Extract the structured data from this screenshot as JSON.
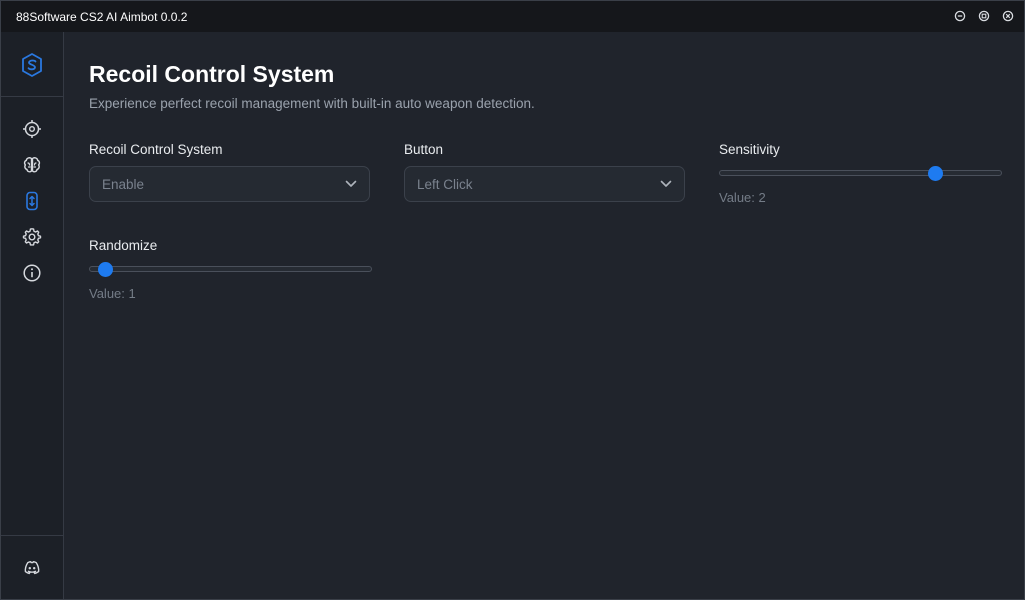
{
  "window": {
    "title": "88Software CS2 AI Aimbot 0.0.2",
    "controls": [
      "minimize-icon",
      "maximize-icon",
      "close-icon"
    ]
  },
  "sidebar": {
    "logo": "logo-icon",
    "items": [
      {
        "name": "aim-target-icon",
        "active": false
      },
      {
        "name": "brain-icon",
        "active": false
      },
      {
        "name": "recoil-icon",
        "active": true
      },
      {
        "name": "gear-icon",
        "active": false
      },
      {
        "name": "info-icon",
        "active": false
      }
    ],
    "bottom": "discord-icon"
  },
  "page": {
    "title": "Recoil Control System",
    "subtitle": "Experience perfect recoil management with built-in auto weapon detection."
  },
  "fields": {
    "recoil": {
      "label": "Recoil Control System",
      "value": "Enable"
    },
    "button": {
      "label": "Button",
      "value": "Left Click"
    },
    "sensitivity": {
      "label": "Sensitivity",
      "value_prefix": "Value: ",
      "value": "2",
      "level": 0.78
    },
    "randomize": {
      "label": "Randomize",
      "value_prefix": "Value: ",
      "value": "1",
      "level": 0.03
    }
  },
  "colors": {
    "accent": "#1e7bf0",
    "background": "#20242c",
    "titlebar": "#15171b",
    "muted_text": "#747c87"
  }
}
